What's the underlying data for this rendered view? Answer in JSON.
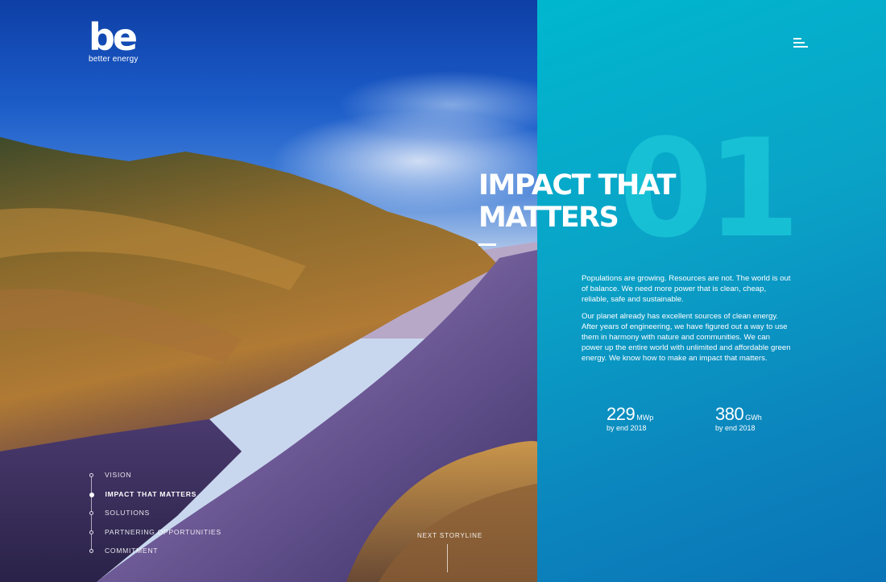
{
  "brand": {
    "mark": "be",
    "name": "better energy"
  },
  "hero": {
    "number": "01",
    "headline_line1": "IMPACT THAT",
    "headline_line2": "MATTERS"
  },
  "body": {
    "paragraph1": "Populations are growing. Resources are not. The world is out of balance. We need more power that is clean, cheap, reliable, safe and sustainable.",
    "paragraph2": "Our planet already has excellent sources of clean energy. After years of engineering, we have figured out a way to use them in harmony with nature and communities. We can power up the entire world with unlimited and affordable green energy. We know how to make an impact that matters."
  },
  "stats": [
    {
      "value": "229",
      "unit": "MWp",
      "note": "by end 2018"
    },
    {
      "value": "380",
      "unit": "GWh",
      "note": "by end 2018"
    }
  ],
  "storyline": {
    "items": [
      {
        "label": "VISION",
        "active": false
      },
      {
        "label": "IMPACT THAT MATTERS",
        "active": true
      },
      {
        "label": "SOLUTIONS",
        "active": false
      },
      {
        "label": "PARTNERING OPPORTUNITIES",
        "active": false
      },
      {
        "label": "COMMITMENT",
        "active": false
      }
    ],
    "next_label": "NEXT STORYLINE"
  },
  "colors": {
    "panel_teal": "#00b7cf",
    "panel_blue": "#0a74b6",
    "number_tint": "#19c3d6"
  },
  "icons": {
    "menu": "hamburger-menu-icon"
  }
}
